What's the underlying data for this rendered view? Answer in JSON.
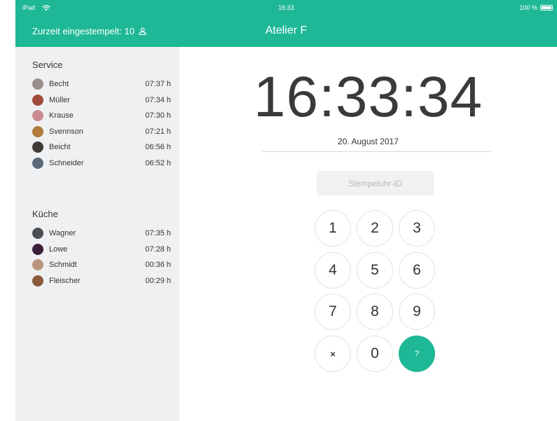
{
  "status": {
    "device": "iPad",
    "time": "16:33",
    "battery": "100 %"
  },
  "header": {
    "clocked_in": "Zurzeit eingestempelt: 10",
    "title": "Atelier F"
  },
  "colors": {
    "accent": "#1fb896",
    "sidebar_bg": "#eff0f2"
  },
  "groups": [
    {
      "title": "Service",
      "staff": [
        {
          "name": "Becht",
          "time": "07:37 h",
          "avatar_color": "#9a8f8a"
        },
        {
          "name": "Müller",
          "time": "07:34 h",
          "avatar_color": "#a14a3a"
        },
        {
          "name": "Krause",
          "time": "07:30 h",
          "avatar_color": "#c98b8f"
        },
        {
          "name": "Svennson",
          "time": "07:21 h",
          "avatar_color": "#b07a3a"
        },
        {
          "name": "Beicht",
          "time": "06:56 h",
          "avatar_color": "#3e3a36"
        },
        {
          "name": "Schneider",
          "time": "06:52 h",
          "avatar_color": "#5a6a78"
        }
      ]
    },
    {
      "title": "Küche",
      "staff": [
        {
          "name": "Wagner",
          "time": "07:35 h",
          "avatar_color": "#4a4e50"
        },
        {
          "name": "Lowe",
          "time": "07:28 h",
          "avatar_color": "#3a1f3a"
        },
        {
          "name": "Schmidt",
          "time": "00:36 h",
          "avatar_color": "#b8957a"
        },
        {
          "name": "Fleischer",
          "time": "00:29 h",
          "avatar_color": "#8a5a3a"
        }
      ]
    }
  ],
  "clock": {
    "time": "16:33:34",
    "date": "20. August 2017"
  },
  "input": {
    "placeholder": "Stempeluhr-ID"
  },
  "keypad": [
    "1",
    "2",
    "3",
    "4",
    "5",
    "6",
    "7",
    "8",
    "9",
    "×",
    "0",
    "?"
  ]
}
